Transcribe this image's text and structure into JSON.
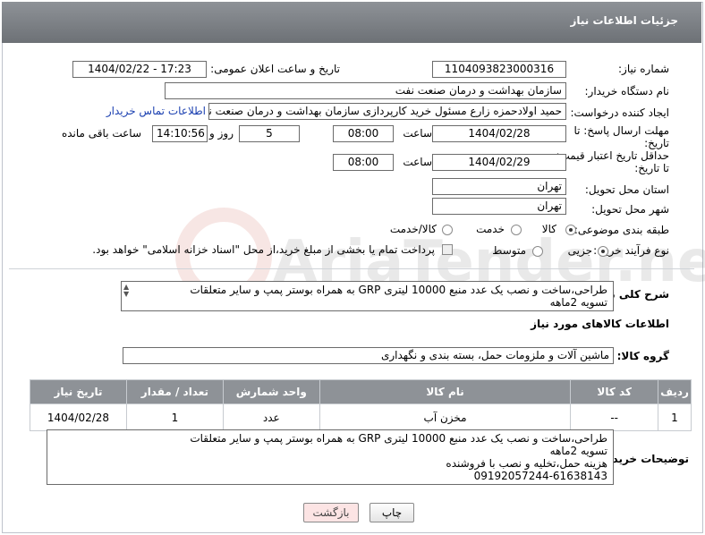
{
  "header": {
    "title": "جزئیات اطلاعات نیاز"
  },
  "fields": {
    "need_number_label": "شماره نیاز:",
    "need_number": "1104093823000316",
    "announce_label": "تاریخ و ساعت اعلان عمومی:",
    "announce_value": "1404/02/22 - 17:23",
    "buyer_org_label": "نام دستگاه خریدار:",
    "buyer_org": "سازمان بهداشت و درمان صنعت نفت",
    "creator_label": "ایجاد کننده درخواست:",
    "creator": "حمید اولادحمزه زارع مسئول خرید کارپردازی سازمان بهداشت و درمان صنعت نفت",
    "contact_link": "اطلاعات تماس خریدار",
    "deadline_label_1": "مهلت ارسال پاسخ: تا",
    "deadline_label_2": "تاریخ:",
    "deadline_date": "1404/02/28",
    "time_label": "ساعت",
    "deadline_time": "08:00",
    "days_value": "5",
    "days_label": "روز و",
    "remaining_time": "14:10:56",
    "remaining_label": "ساعت باقی مانده",
    "validity_label_1": "حداقل تاریخ اعتبار قیمت:",
    "validity_label_2": "تا تاریخ:",
    "validity_date": "1404/02/29",
    "validity_time_label": "ساعت",
    "validity_time": "08:00",
    "province_label": "استان محل تحویل:",
    "province": "تهران",
    "city_label": "شهر محل تحویل:",
    "city": "تهران",
    "category_label": "طبقه بندی موضوعی:",
    "category_options": [
      "کالا",
      "خدمت",
      "کالا/خدمت"
    ],
    "process_label": "نوع فرآیند خرید :",
    "process_options": [
      "جزیی",
      "متوسط"
    ],
    "payment_note": "پرداخت تمام یا بخشی از مبلغ خرید،از محل \"اسناد خزانه اسلامی\" خواهد بود.",
    "description_label": "شرح کلی نیاز:",
    "description": "طراحی،ساخت و نصب یک عدد منبع 10000 لیتری GRP به همراه بوستر پمپ و سایر متعلقات\nتسویه 2ماهه",
    "goods_info_title": "اطلاعات کالاهای مورد نیاز",
    "goods_group_label": "گروه کالا:",
    "goods_group": "ماشین آلات و ملزومات حمل، بسته بندی و نگهداری"
  },
  "table": {
    "headers": [
      "ردیف",
      "کد کالا",
      "نام کالا",
      "واحد شمارش",
      "تعداد / مقدار",
      "تاریخ نیاز"
    ],
    "rows": [
      [
        "1",
        "--",
        "مخزن آب",
        "عدد",
        "1",
        "1404/02/28"
      ]
    ]
  },
  "buyer_notes": {
    "label": "توضیحات خریدار:",
    "text": "طراحی،ساخت و نصب یک عدد منبع 10000 لیتری GRP به همراه بوستر پمپ و سایر متعلقات\nتسویه 2ماهه\nهزینه حمل،تخلیه و نصب با فروشنده\n09192057244-61638143"
  },
  "buttons": {
    "print": "چاپ",
    "back": "بازگشت"
  },
  "watermark": "AriaTender.neT"
}
